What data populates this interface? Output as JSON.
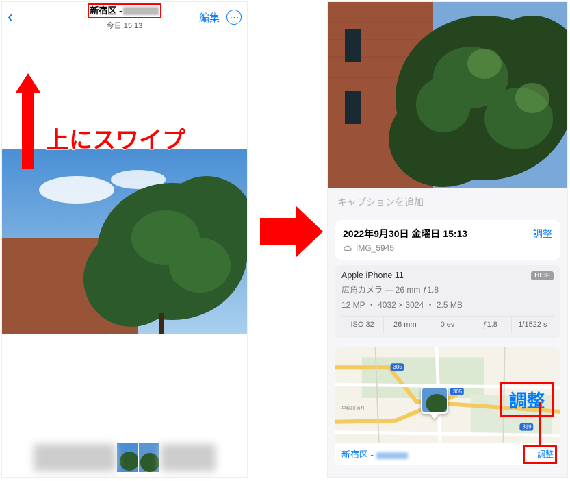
{
  "left": {
    "title_location": "新宿区 -",
    "title_sub": "今日 15:13",
    "edit": "編集",
    "swipe_text": "上にスワイプ"
  },
  "right": {
    "caption_placeholder": "キャプションを追加",
    "date": "2022年9月30日 金曜日 15:13",
    "filename": "IMG_5945",
    "adjust": "調整",
    "camera": {
      "device": "Apple iPhone 11",
      "format": "HEIF",
      "lens": "広角カメラ — 26 mm ƒ1.8",
      "specs": "12 MP ・ 4032 × 3024 ・ 2.5 MB",
      "cells": {
        "iso": "ISO 32",
        "focal": "26 mm",
        "ev": "0 ev",
        "aperture": "ƒ1.8",
        "shutter": "1/1522 s"
      }
    },
    "map": {
      "adjust_big": "調整",
      "location": "新宿区 -",
      "adjust_small": "調整",
      "route_labels": [
        "305",
        "305",
        "319"
      ],
      "road_label": "早稲田通り"
    }
  }
}
